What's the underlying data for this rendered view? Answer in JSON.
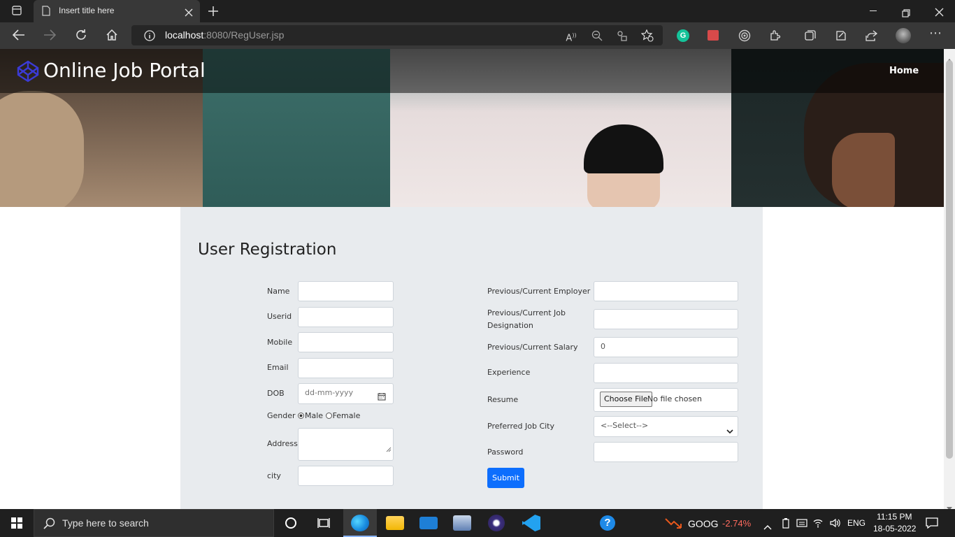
{
  "browser": {
    "tab_title": "Insert title here",
    "url_host": "localhost",
    "url_path": ":8080/RegUser.jsp"
  },
  "site": {
    "brand": "Online Job Portal",
    "nav_home": "Home"
  },
  "form": {
    "title": "User Registration",
    "left": {
      "name_label": "Name",
      "userid_label": "Userid",
      "mobile_label": "Mobile",
      "email_label": "Email",
      "dob_label": "DOB",
      "dob_placeholder": "dd-mm-yyyy",
      "gender_label": "Gender",
      "gender_male": "Male",
      "gender_female": "Female",
      "gender_selected": "Male",
      "address_label": "Address",
      "city_label": "city"
    },
    "right": {
      "employer_label": "Previous/Current Employer",
      "designation_label_1": "Previous/Current Job",
      "designation_label_2": "Designation",
      "salary_label": "Previous/Current Salary",
      "salary_value": "0",
      "experience_label": "Experience",
      "resume_label": "Resume",
      "choose_file": "Choose File",
      "no_file": "No file chosen",
      "city_label": "Preferred Job City",
      "city_selected": "<--Select-->",
      "password_label": "Password"
    },
    "submit": "Submit"
  },
  "taskbar": {
    "search_placeholder": "Type here to search",
    "stock_symbol": "GOOG",
    "stock_change": "-2.74%",
    "language": "ENG",
    "time": "11:15 PM",
    "date": "18-05-2022"
  }
}
